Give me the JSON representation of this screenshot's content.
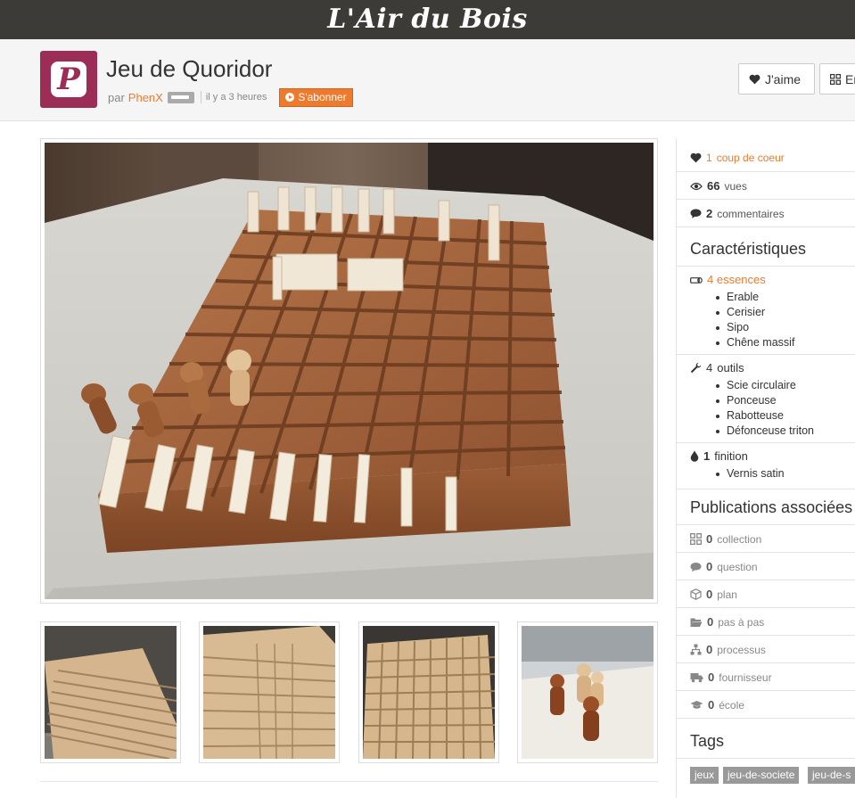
{
  "site": {
    "brand": "L'Air du Bois"
  },
  "project": {
    "title": "Jeu de Quoridor",
    "by_label": "par",
    "author": "PhenX",
    "time": "il y a 3 heures",
    "subscribe_label": "S'abonner"
  },
  "actions": {
    "like_label": "J'aime",
    "collect_label": "En"
  },
  "stats": {
    "likes_count": "1",
    "likes_label": "coup de coeur",
    "views_count": "66",
    "views_label": "vues",
    "comments_count": "2",
    "comments_label": "commentaires"
  },
  "characteristics": {
    "heading": "Caractéristiques",
    "woods": {
      "label": "4 essences",
      "items": [
        "Erable",
        "Cerisier",
        "Sipo",
        "Chêne massif"
      ]
    },
    "tools": {
      "count": "4",
      "label": "outils",
      "items": [
        "Scie circulaire",
        "Ponceuse",
        "Rabotteuse",
        "Défonceuse triton"
      ]
    },
    "finish": {
      "count": "1",
      "label": "finition",
      "items": [
        "Vernis satin"
      ]
    }
  },
  "related": {
    "heading": "Publications associées",
    "items": [
      {
        "count": "0",
        "label": "collection",
        "icon": "grid-icon"
      },
      {
        "count": "0",
        "label": "question",
        "icon": "speech-bubble-icon"
      },
      {
        "count": "0",
        "label": "plan",
        "icon": "cube-icon"
      },
      {
        "count": "0",
        "label": "pas à pas",
        "icon": "folder-icon"
      },
      {
        "count": "0",
        "label": "processus",
        "icon": "sitemap-icon"
      },
      {
        "count": "0",
        "label": "fournisseur",
        "icon": "truck-icon"
      },
      {
        "count": "0",
        "label": "école",
        "icon": "graduation-cap-icon"
      }
    ]
  },
  "tags": {
    "heading": "Tags",
    "items": [
      "jeux",
      "jeu-de-societe",
      "jeu-de-s"
    ]
  },
  "colors": {
    "accent": "#ee7a2d",
    "topbar": "#3d3b37",
    "avatar": "#9b2d57"
  }
}
